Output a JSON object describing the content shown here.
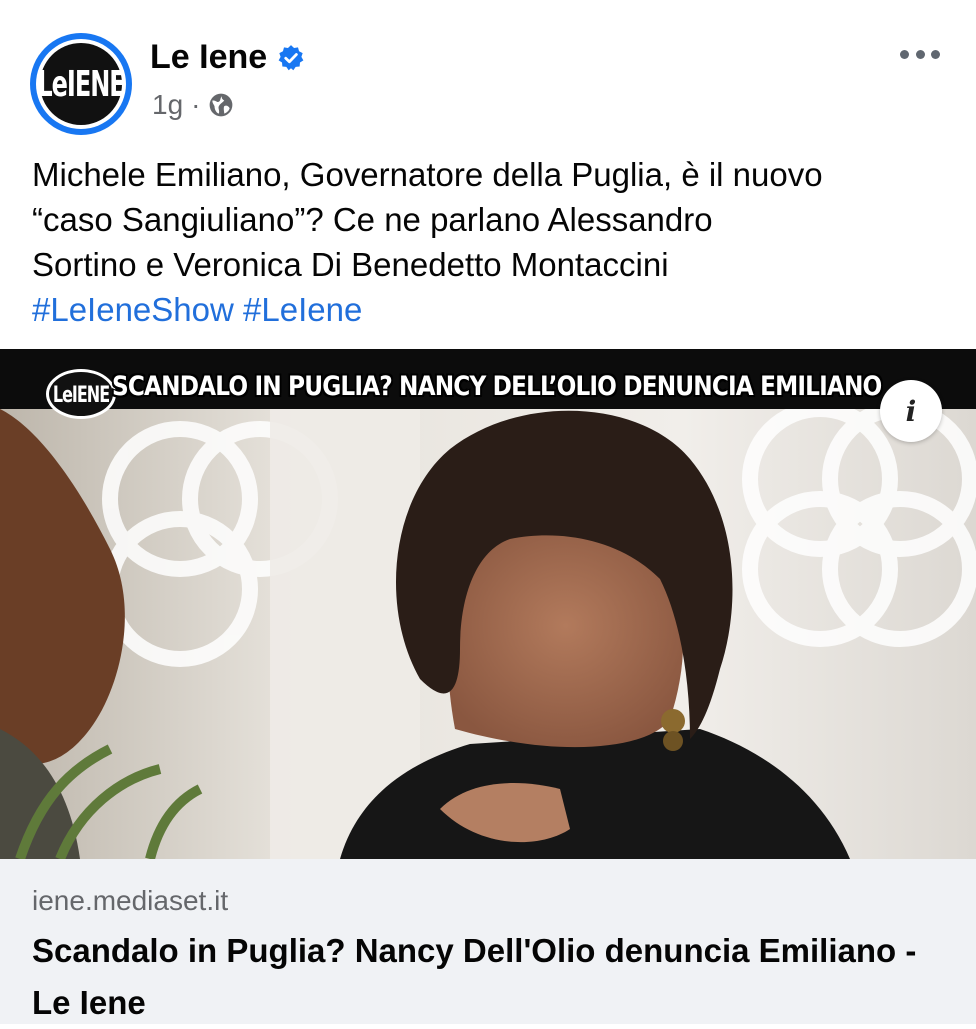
{
  "post": {
    "page_name": "Le Iene",
    "avatar_logo_text": "LeIENE",
    "time": "1g",
    "separator": "·",
    "text_lines": [
      "Michele Emiliano, Governatore della Puglia, è il nuovo",
      "“caso Sangiuliano”? Ce ne parlano Alessandro",
      "Sortino e Veronica Di Benedetto Montaccini"
    ],
    "hashtags": [
      "#LeIeneShow",
      "#LeIene"
    ]
  },
  "media": {
    "banner_logo_text": "LeIENE",
    "banner_title": "SCANDALO IN PUGLIA? NANCY DELL’OLIO DENUNCIA EMILIANO",
    "info_icon": "i"
  },
  "link": {
    "domain": "iene.mediaset.it",
    "title": "Scandalo in Puglia? Nancy Dell'Olio denuncia Emiliano - Le Iene"
  },
  "colors": {
    "accent": "#1877f2",
    "hashtag": "#216fdb",
    "muted": "#65676b",
    "card_bg": "#f0f2f5"
  }
}
